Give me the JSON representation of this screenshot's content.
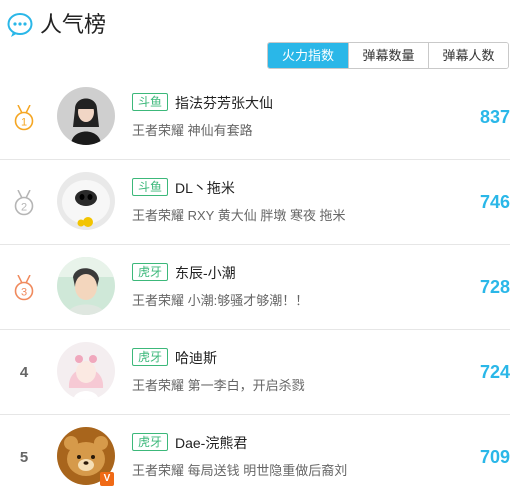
{
  "header": {
    "title": "人气榜",
    "icon": "chat-bubble-icon",
    "accent": "#2ab7e8"
  },
  "tabs": [
    {
      "label": "火力指数",
      "active": true
    },
    {
      "label": "弹幕数量",
      "active": false
    },
    {
      "label": "弹幕人数",
      "active": false
    }
  ],
  "rows": [
    {
      "rank": "1",
      "medal": "gold",
      "platform": "斗鱼",
      "name": "指法芬芳张大仙",
      "sub": "王者荣耀 神仙有套路",
      "score": "837",
      "avatar": "person-portrait"
    },
    {
      "rank": "2",
      "medal": "silver",
      "platform": "斗鱼",
      "name": "DL丶拖米",
      "sub": "王者荣耀 RXY 黄大仙 胖墩 寒夜 拖米",
      "score": "746",
      "avatar": "dog-face"
    },
    {
      "rank": "3",
      "medal": "bronze",
      "platform": "虎牙",
      "name": "东辰-小潮",
      "sub": "王者荣耀 小潮:够骚才够潮！！",
      "score": "728",
      "avatar": "person-selfie"
    },
    {
      "rank": "4",
      "medal": "",
      "platform": "虎牙",
      "name": "哈迪斯",
      "sub": "王者荣耀 第一李白，开启杀戮",
      "score": "724",
      "avatar": "anime-girl"
    },
    {
      "rank": "5",
      "medal": "",
      "platform": "虎牙",
      "name": "Dae-浣熊君",
      "sub": "王者荣耀 每局送钱 明世隐重做后裔刘",
      "score": "709",
      "avatar": "bear-cartoon",
      "verified": "V"
    }
  ],
  "colors": {
    "gold": "#f5a623",
    "silver": "#b5b5b5",
    "bronze": "#f08a5d",
    "platform_border": "#3cb87a"
  }
}
